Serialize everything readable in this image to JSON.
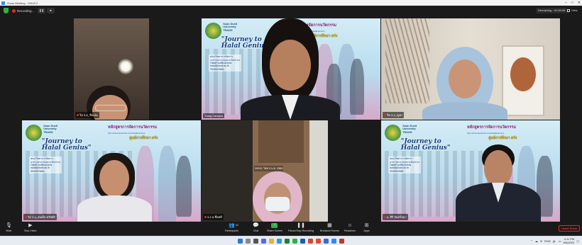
{
  "window": {
    "title": "Zoom Meeting - ลงบ.ศ.2"
  },
  "topbar": {
    "recording_label": "Recording…",
    "pause_symbol": "❚❚",
    "stop_symbol": "■",
    "remaining": "Remaining : 00:28:08",
    "view_label": "View"
  },
  "slide": {
    "university": "Suan Dusit University TRANG",
    "title": "\"Journey to Halal Genius\"",
    "thai_heading": "หลักสูตรการจัดการนวัตกรรม",
    "thai_sub": "http://www.facebook.com/halalbusiness",
    "thai_highlight": "ศูนย์การศึกษา ตรัง",
    "contact_lines": [
      "คณะวิทยาการจัดการ",
      "อาหารฮาลาลและนวัตกรรม",
      "HalalFoodBusiness",
      "halal@dusit.ac.th",
      "0945520684"
    ]
  },
  "participants": [
    {
      "name": "วิด 3-5_ชื่อเล่น",
      "muted": true
    },
    {
      "name": "Trang Campus",
      "muted": false,
      "active": true
    },
    {
      "name": "วิด 3-4_ญูหา",
      "muted": true
    },
    {
      "name": "วิด 3-4_สมเด็จ ทรัพย์สิ",
      "muted": true
    },
    {
      "name": "3-2 อ.ชื่อทดี",
      "muted": true,
      "caption": "20031 วันท 3 พ.ย. 2565"
    },
    {
      "name": "อ. ศิริ จันทร์สมา",
      "muted": true
    }
  ],
  "toolbar": {
    "mute": "Mute",
    "stop_video": "Stop Video",
    "participants": "Participants",
    "participants_count": "42",
    "chat": "Chat",
    "share_screen": "Share Screen",
    "pause_recording": "Pause/Stop Recording",
    "breakout_rooms": "Breakout Rooms",
    "reactions": "Reactions",
    "apps": "Apps",
    "leave": "Leave Room"
  },
  "taskbar": {
    "language": "ENG",
    "time": "4:11 PM",
    "date": "6/5/2022"
  },
  "colors": {
    "share_green": "#2fb344",
    "record_red": "#e02828",
    "active_border": "#c6d83a"
  }
}
